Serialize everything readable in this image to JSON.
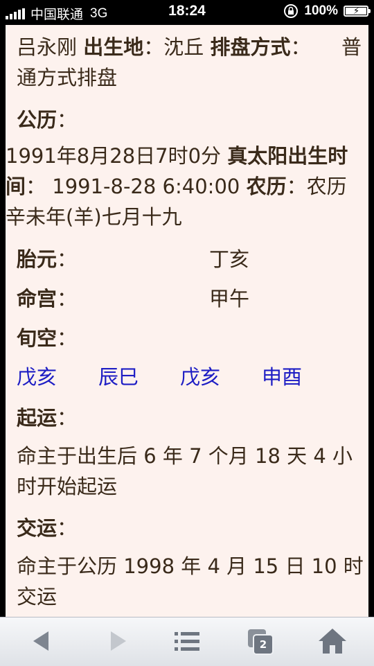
{
  "status_bar": {
    "carrier": "中国联通",
    "network": "3G",
    "time": "18:24",
    "battery": "100%",
    "battery_level": 1.0
  },
  "content": {
    "line1_name": "吕永刚",
    "birthplace_label": "出生地",
    "birthplace_value": "沈丘",
    "method_label": "排盘方式",
    "method_value_a": "普",
    "method_value_b": "通方式排盘",
    "gongli_label": "公历",
    "gongli_value": "1991年8月28日7时0分",
    "true_solar_label_a": "真太阳出生时",
    "true_solar_label_b": "间",
    "true_solar_value": "1991-8-28 6:40:00",
    "nongli_label": "农历",
    "nongli_value_a": "农历",
    "nongli_value_b": "辛未年(羊)七月十九",
    "taiyuan_label": "胎元",
    "taiyuan_value": "丁亥",
    "minggong_label": "命宫",
    "minggong_value": "甲午",
    "xunkong_label": "旬空",
    "xunkong_values": [
      "戊亥",
      "辰巳",
      "戊亥",
      "申酉"
    ],
    "qiyun_label": "起运",
    "qiyun_text_a": "命主于出生后 6 年 7 个月 18 天 4 小",
    "qiyun_text_b": "时开始起运",
    "jiaoyun_label": "交运",
    "jiaoyun_text_a": "命主于公历 1998 年 4 月 15 日 10 时",
    "jiaoyun_text_b": "交运",
    "colon": "："
  },
  "toolbar": {
    "tabs_count": "2",
    "icons": [
      "back-arrow-icon",
      "forward-arrow-icon",
      "bookmarks-icon",
      "tabs-icon",
      "home-icon"
    ]
  },
  "colors": {
    "page_bg": "#fdf2ee",
    "text": "#3a2a1a",
    "link_blue": "#1d1dc4"
  }
}
